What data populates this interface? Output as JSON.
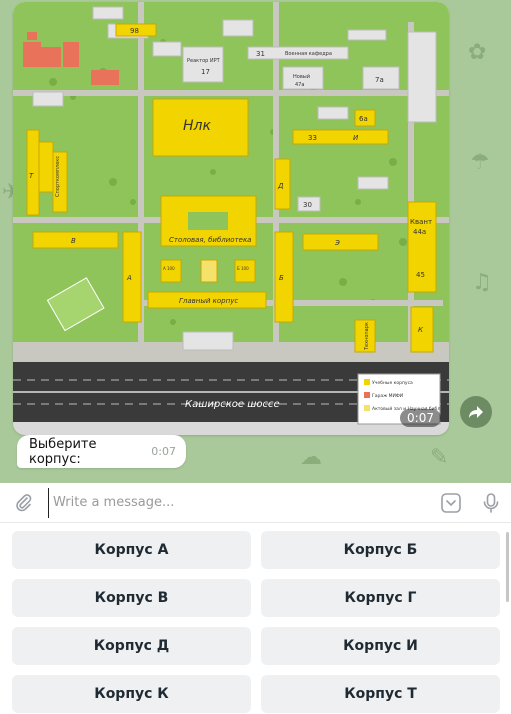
{
  "colors": {
    "chat_background": "#a9c99a",
    "building_yellow": "#f2d400",
    "garage_red": "#e8735a",
    "grass_green": "#8fc45a",
    "road_dark": "#3a3a3a"
  },
  "photo_message": {
    "time": "0:07",
    "map_labels": {
      "nlk": "Нлк",
      "canteen_library": "Столовая, библиотека",
      "main_building": "Главный корпус",
      "highway": "Каширское шоссе",
      "reactor": "Реактор ИРТ",
      "reactor_num": "17",
      "military": "Военная кафедра",
      "new_building": "Новый",
      "new_building_num": "47а",
      "kvant": "Квант",
      "kvant_num": "44а",
      "letters": {
        "a": "А",
        "b": "Б",
        "v": "В",
        "g": "Г",
        "d": "Д",
        "e": "Э",
        "i": "И",
        "k": "К",
        "t": "Т"
      },
      "numbers": {
        "n98": "98",
        "n31": "31",
        "n7a": "7а",
        "n6a": "6а",
        "n33": "33",
        "n30": "30",
        "n45": "45",
        "n_a100": "А 100",
        "n_b100": "Б 100"
      },
      "sports": "Спорткомплекс",
      "tech": "Технопарк"
    },
    "legend": {
      "items": [
        "Учебные корпуса",
        "Гараж МИФИ",
        "Актовый зал и Научная библ."
      ]
    }
  },
  "text_message": {
    "text": "Выберите корпус:",
    "time": "0:07"
  },
  "composer": {
    "placeholder": "Write a message..."
  },
  "keyboard": {
    "buttons": [
      "Корпус А",
      "Корпус Б",
      "Корпус В",
      "Корпус Г",
      "Корпус Д",
      "Корпус И",
      "Корпус К",
      "Корпус Т"
    ]
  },
  "icons": {
    "attach": "paperclip-icon",
    "commands": "chevron-down-square-icon",
    "voice": "microphone-icon",
    "share": "share-arrow-icon"
  }
}
